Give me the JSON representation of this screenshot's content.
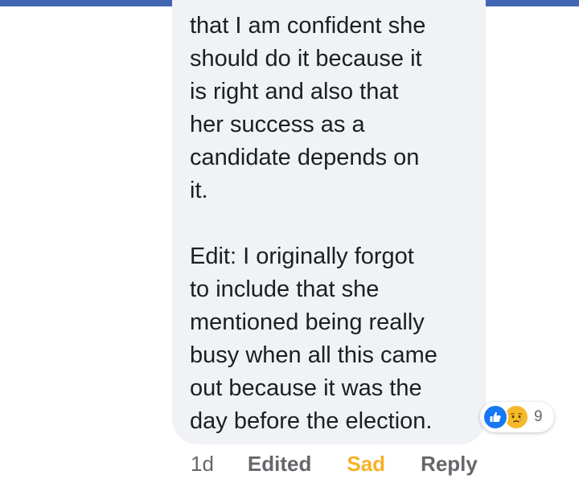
{
  "header": {
    "bar_color": "#4267b2"
  },
  "comment": {
    "lines": [
      "that I am confident she",
      "should do it because it",
      "is right and also that",
      "her success as a",
      "candidate depends on",
      "it.",
      "Edit: I originally forgot",
      "to include that she",
      "mentioned being really",
      "busy when all this came",
      "out because it was the",
      "day before the election."
    ]
  },
  "reactions": {
    "icons": [
      "like-icon",
      "sad-icon"
    ],
    "count": "9"
  },
  "actions": {
    "time": "1d",
    "edited": "Edited",
    "reaction_label": "Sad",
    "reply": "Reply"
  },
  "colors": {
    "bubble_bg": "#f0f2f5",
    "like_blue": "#1877f2",
    "sad_yellow": "#f7b928",
    "muted_text": "#65676b"
  }
}
